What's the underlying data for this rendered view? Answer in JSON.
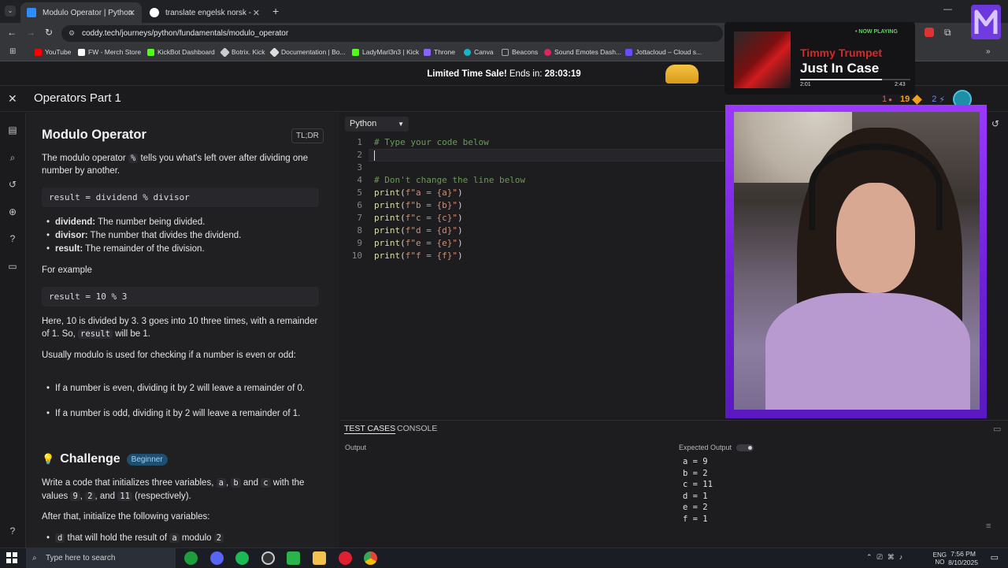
{
  "browser": {
    "tabs": [
      {
        "title": "Modulo Operator | Python",
        "active": true
      },
      {
        "title": "translate engelsk norsk - Googl",
        "active": false
      }
    ],
    "url": "coddy.tech/journeys/python/fundamentals/modulo_operator",
    "bookmarks": [
      "YouTube",
      "FW - Merch Store",
      "KickBot Dashboard",
      "Botrix. Kick",
      "Documentation | Bo...",
      "LadyMarl3n3 | Kick",
      "Throne",
      "Canva",
      "Beacons",
      "Sound Emotes Dash...",
      "Jottacloud – Cloud s..."
    ]
  },
  "promo": {
    "text": "Limited Time Sale!",
    "ends_label": "Ends in:",
    "countdown": "28:03:19"
  },
  "course": {
    "title": "Operators Part 1"
  },
  "stats": {
    "hearts": "1",
    "streak": "19",
    "bolts": "2"
  },
  "lesson": {
    "title": "Modulo Operator",
    "tldr": "TL;DR",
    "intro_a": "The modulo operator",
    "intro_op": "%",
    "intro_b": "tells you what's left over after dividing one number by another.",
    "syntax": "result = dividend % divisor",
    "terms": [
      {
        "term": "dividend:",
        "desc": "The number being divided."
      },
      {
        "term": "divisor:",
        "desc": "The number that divides the dividend."
      },
      {
        "term": "result:",
        "desc": "The remainder of the division."
      }
    ],
    "example_label": "For example",
    "example_code": "result = 10 % 3",
    "explain_a": "Here, 10 is divided by 3. 3 goes into 10 three times, with a remainder of 1. So,",
    "explain_code": "result",
    "explain_b": "will be 1.",
    "usage": "Usually modulo is used for checking if a number is even or odd:",
    "rules": [
      "If a number is even, dividing it by 2 will leave a remainder of 0.",
      "If a number is odd, dividing it by 2 will leave a remainder of 1."
    ],
    "challenge_title": "Challenge",
    "level": "Beginner",
    "challenge_a": "Write a code that initializes three variables,",
    "var_a": "a",
    "var_b": "b",
    "and": "and",
    "var_c": "c",
    "with": "with",
    "challenge_b": "the values",
    "val_9": "9",
    "val_2": "2",
    "val_11": "11",
    "respectively": "(respectively).",
    "after": "After that, initialize the following variables:",
    "task_d_a": "d",
    "task_d_b": "that will hold the result of",
    "task_d_c": "a",
    "task_d_d": "modulo",
    "task_d_e": "2"
  },
  "editor": {
    "language": "Python",
    "lines": [
      {
        "n": "1",
        "text": "# Type your code below",
        "kind": "comment"
      },
      {
        "n": "2",
        "text": "",
        "kind": "plain"
      },
      {
        "n": "3",
        "text": "",
        "kind": "plain"
      },
      {
        "n": "4",
        "text": "# Don't change the line below",
        "kind": "comment"
      },
      {
        "n": "5",
        "text": "print(f\"a = {a}\")",
        "kind": "print"
      },
      {
        "n": "6",
        "text": "print(f\"b = {b}\")",
        "kind": "print"
      },
      {
        "n": "7",
        "text": "print(f\"c = {c}\")",
        "kind": "print"
      },
      {
        "n": "8",
        "text": "print(f\"d = {d}\")",
        "kind": "print"
      },
      {
        "n": "9",
        "text": "print(f\"e = {e}\")",
        "kind": "print"
      },
      {
        "n": "10",
        "text": "print(f\"f = {f}\")",
        "kind": "print"
      }
    ]
  },
  "panel": {
    "tab_tests": "TEST CASES",
    "tab_console": "CONSOLE",
    "output_label": "Output",
    "expected_label": "Expected Output",
    "expected": [
      "a = 9",
      "b = 2",
      "c = 11",
      "d = 1",
      "e = 2",
      "f = 1"
    ]
  },
  "now_playing": {
    "badge": "• NOW PLAYING",
    "artist": "Timmy Trumpet",
    "song": "Just In Case",
    "elapsed": "2:01",
    "total": "2:43",
    "progress": 0.74
  },
  "taskbar": {
    "search_placeholder": "Type here to search",
    "lang": "ENG",
    "region": "NO",
    "time": "7:56 PM",
    "date": "8/10/2025"
  }
}
